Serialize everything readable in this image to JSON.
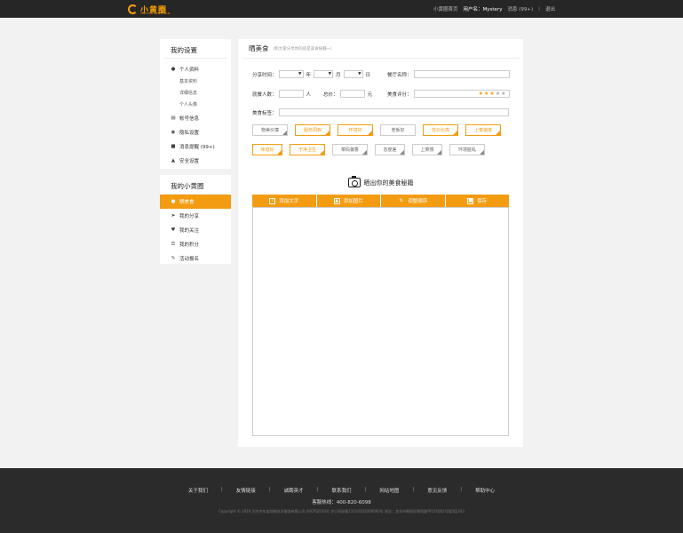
{
  "header": {
    "logo_text": "小黄圈",
    "logo_sub": "XIAOHUANGQUAN",
    "nav": {
      "home": "小黄圈首页",
      "user": "用户名：Mystery",
      "messages": "消息 (99+)",
      "sep": "|",
      "logout": "退出"
    }
  },
  "sidebar": {
    "settings_title": "我的设置",
    "profile": "个人资料",
    "profile_sub": [
      "基本资料",
      "详细信息",
      "个人头像"
    ],
    "account": "帐号信息",
    "privacy": "隐私设置",
    "notify": "消息提醒 (99+)",
    "security": "安全设置",
    "circle_title": "我的小黄圈",
    "circle_items": [
      "晒美食",
      "我的分享",
      "我的关注",
      "我的积分",
      "活动报名"
    ]
  },
  "main": {
    "title": "晒美食",
    "subtitle": "(和大家分享你的就是美食秘籍~)",
    "form": {
      "share_time": "分享时间：",
      "year": "年",
      "month": "月",
      "day": "日",
      "restaurant": "餐厅名称：",
      "diners": "就餐人数：",
      "person_unit": "人",
      "total": "总价：",
      "yuan": "元",
      "rating": "美食评分：",
      "rating_value": 3,
      "rating_max": 5,
      "food_tag": "美食标签："
    },
    "tags_row1": [
      "物美价廉",
      "服务周到",
      "环境好",
      "老板好",
      "性价比高",
      "上菜速度"
    ],
    "tags_row2": [
      "味道好",
      "干净卫生",
      "菜码偏香",
      "态度差",
      "上菜慢",
      "环境脏乱"
    ],
    "showcase": "晒出你的美食秘籍",
    "toolbar": [
      "添加文字",
      "添加图片",
      "调整顺序",
      "保存"
    ]
  },
  "footer": {
    "links": [
      "关于我们",
      "友情链接",
      "诚聘英才",
      "联系我们",
      "网站地图",
      "意见反馈",
      "帮助中心"
    ],
    "sep": "|",
    "hotline": "客服热线：400-820-6098",
    "copyright": "Copyright © 2016 北京市年度网络技术服务有限公司 京ICP证010号 京公网安备11010502000000号 地址：北京市朝阳区朝阳路甲15号院2号楼3层303"
  },
  "colors": {
    "accent": "#f39c12",
    "header_bg": "#262626",
    "footer_bg": "#2b2b2b"
  }
}
